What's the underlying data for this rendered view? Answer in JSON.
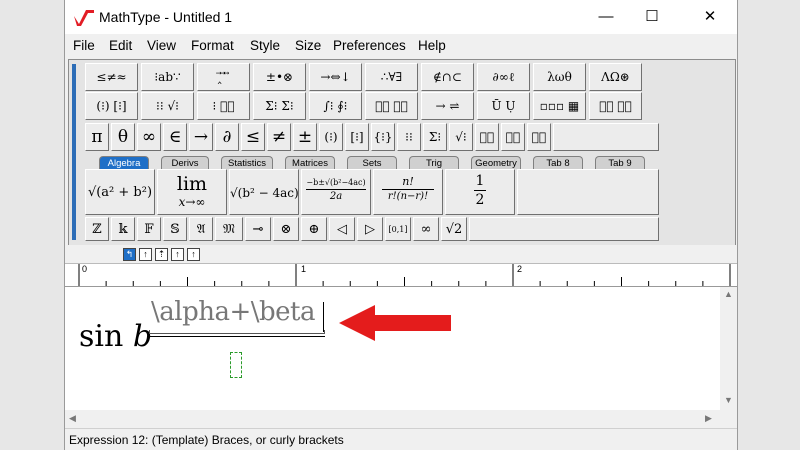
{
  "window": {
    "title": "MathType - Untitled 1"
  },
  "window_controls": {
    "minimize": "—",
    "maximize": "☐",
    "close": "✕"
  },
  "menu": [
    "File",
    "Edit",
    "View",
    "Format",
    "Style",
    "Size",
    "Preferences",
    "Help"
  ],
  "palette_row1": [
    "≤≠≈",
    "⁝ab∵",
    "‸⃗ ⃗ ⃡",
    "±•⊗",
    "→⇔↓",
    "∴∀∃",
    "∉∩⊂",
    "∂∞ℓ",
    "λωθ",
    "ΛΩ⊛"
  ],
  "palette_row2": [
    "(⁝) [⁝]",
    "⁝⁝ √⁝",
    "⁝ ⁝⃞",
    "Σ⁝ Σ⁝",
    "∫⁝ ∮⁝",
    "⁝⃞ ⁝⃞",
    "→ ⇌",
    "Ū Ụ",
    "▫▫▫ ▦",
    "⁝⃞ ⁝⃞"
  ],
  "symbol_row": [
    "π",
    "θ",
    "∞",
    "∈",
    "→",
    "∂",
    "≤",
    "≠",
    "±",
    "(⁝)",
    "[⁝]",
    "{⁝}",
    "⁝⁝",
    "Σ⁝",
    "√⁝",
    "⁝⃞",
    "⁝⃞",
    "⁝⃞"
  ],
  "tabs": [
    "Algebra",
    "Derivs",
    "Statistics",
    "Matrices",
    "Sets",
    "Trig",
    "Geometry",
    "Tab 8",
    "Tab 9"
  ],
  "templates": {
    "pythag": "√(a² + b²)",
    "lim_top": "lim",
    "lim_bottom": "x→∞",
    "disc": "√(b² − 4ac)",
    "quad_top": "−b±√(b²−4ac)",
    "quad_bottom": "2a",
    "fact_top": "n!",
    "fact_bottom": "r!(n−r)!",
    "half_top": "1",
    "half_bottom": "2"
  },
  "small_row": [
    "ℤ",
    "𝕜",
    "𝔽",
    "𝕊",
    "𝔄",
    "𝔐",
    "⊸",
    "⊗",
    "⊕",
    "◁",
    "▷",
    "[0,1]",
    "∞",
    "√2"
  ],
  "nav_buttons": [
    "↰",
    "↑",
    "⇡",
    "↑",
    "↑"
  ],
  "ruler_labels": [
    "0",
    "1",
    "2"
  ],
  "formula": {
    "func": "sin",
    "var": "b",
    "numerator": "\\alpha+\\beta"
  },
  "status": "Expression 12: (Template) Braces, or curly brackets",
  "colors": {
    "accent": "#1f6fc7",
    "arrow": "#e41c1c",
    "logo": "#e21d25"
  }
}
